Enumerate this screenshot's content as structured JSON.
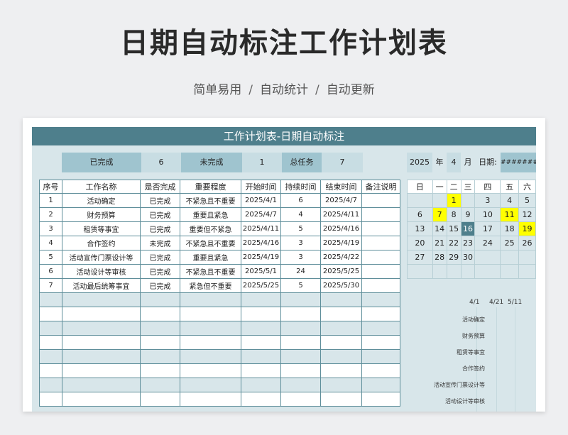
{
  "header": {
    "title": "日期自动标注工作计划表",
    "subtitle_parts": [
      "简单易用",
      "自动统计",
      "自动更新"
    ],
    "separator": "/"
  },
  "sheet": {
    "banner": "工作计划表-日期自动标注",
    "stats": {
      "completed_label": "已完成",
      "completed_value": "6",
      "pending_label": "未完成",
      "pending_value": "1",
      "total_label": "总任务",
      "total_value": "7"
    },
    "date_bar": {
      "year": "2025",
      "year_label": "年",
      "month": "4",
      "month_label": "月",
      "date_label": "日期:",
      "date_value": "########"
    },
    "columns": [
      "序号",
      "工作名称",
      "是否完成",
      "重要程度",
      "开始时间",
      "持续时间",
      "结束时间",
      "备注说明"
    ],
    "rows": [
      [
        "1",
        "活动确定",
        "已完成",
        "不紧急且不重要",
        "2025/4/1",
        "6",
        "2025/4/7",
        ""
      ],
      [
        "2",
        "财务预算",
        "已完成",
        "重要且紧急",
        "2025/4/7",
        "4",
        "2025/4/11",
        ""
      ],
      [
        "3",
        "租赁等事宜",
        "已完成",
        "重要但不紧急",
        "2025/4/11",
        "5",
        "2025/4/16",
        ""
      ],
      [
        "4",
        "合作签约",
        "未完成",
        "不紧急且不重要",
        "2025/4/16",
        "3",
        "2025/4/19",
        ""
      ],
      [
        "5",
        "活动宣传门票设计等",
        "已完成",
        "重要且紧急",
        "2025/4/19",
        "3",
        "2025/4/22",
        ""
      ],
      [
        "6",
        "活动设计等审核",
        "已完成",
        "不紧急且不重要",
        "2025/5/1",
        "24",
        "2025/5/25",
        ""
      ],
      [
        "7",
        "活动最后统筹事宜",
        "已完成",
        "紧急但不重要",
        "2025/5/25",
        "5",
        "2025/5/30",
        ""
      ]
    ],
    "empty_rows": 8,
    "calendar": {
      "weekdays": [
        "日",
        "一",
        "二",
        "三",
        "四",
        "五",
        "六"
      ],
      "weeks": [
        [
          "",
          "",
          "1",
          "",
          "3",
          "4",
          "5"
        ],
        [
          "6",
          "7",
          "8",
          "9",
          "10",
          "11",
          "12"
        ],
        [
          "13",
          "14",
          "15",
          "16",
          "17",
          "18",
          "19"
        ],
        [
          "20",
          "21",
          "22",
          "23",
          "24",
          "25",
          "26"
        ],
        [
          "27",
          "28",
          "29",
          "30",
          "",
          "",
          ""
        ],
        [
          "",
          "",
          "",
          "",
          "",
          "",
          ""
        ]
      ],
      "highlighted_days": [
        "1",
        "7",
        "11",
        "19"
      ],
      "today": "16",
      "highlight_color": "#ffff00",
      "today_color": "#4e7f8c"
    },
    "gantt": {
      "dates": [
        "4/1",
        "4/21",
        "5/11"
      ],
      "tasks": [
        "活动确定",
        "财务预算",
        "租赁等事宜",
        "合作签约",
        "活动宣传门票设计等",
        "活动设计等审核"
      ]
    }
  },
  "colors": {
    "banner": "#4e7f8c",
    "stat_label_bg": "#9fc4cf",
    "stat_value_bg": "#c8dde3",
    "sheet_bg": "#d8e6ea"
  }
}
